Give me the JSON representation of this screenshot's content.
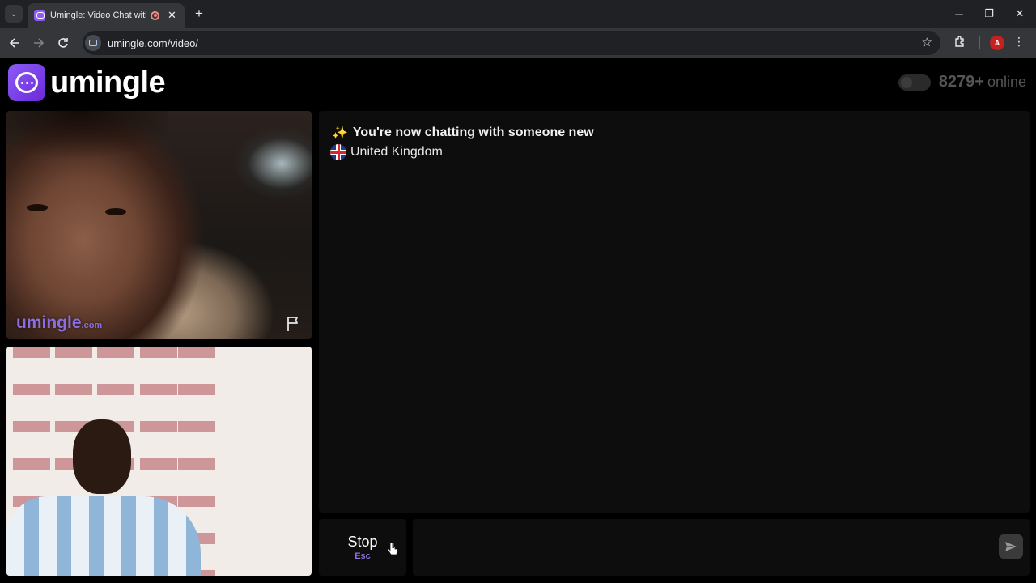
{
  "browser": {
    "tab_title": "Umingle: Video Chat with Strangers",
    "url": "umingle.com/video/",
    "profile_initial": "A",
    "window_controls": {
      "minimize": "─",
      "restore": "❐",
      "close": "✕"
    }
  },
  "header": {
    "logo_text": "umingle",
    "online_count": "8279+",
    "online_label": "online"
  },
  "video": {
    "watermark_brand": "umingle",
    "watermark_tld": ".com"
  },
  "chat": {
    "status_emoji": "✨",
    "status_message": "You're now chatting with someone new",
    "country": "United Kingdom"
  },
  "controls": {
    "stop_label": "Stop",
    "stop_shortcut": "Esc",
    "message_placeholder": ""
  },
  "colors": {
    "accent": "#8b5cf6",
    "background": "#000000",
    "panel": "#0d0d0d"
  }
}
